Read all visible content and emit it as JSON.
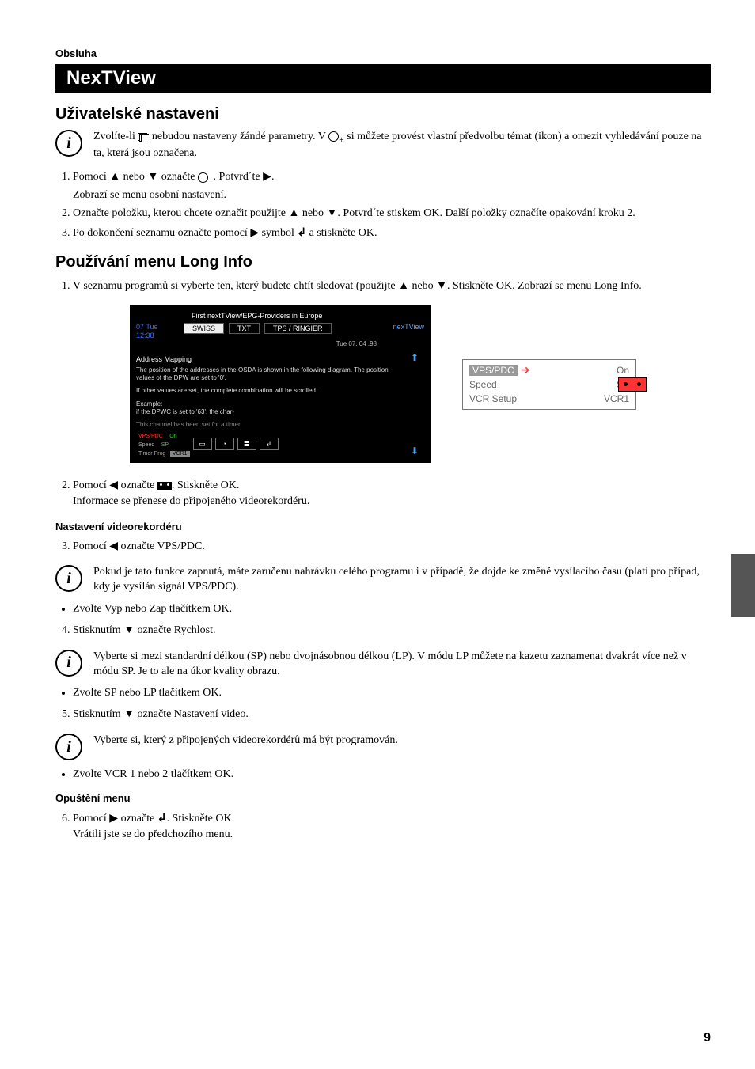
{
  "top_category": "Obsluha",
  "title_bar": "NexTView",
  "section1": {
    "heading": "Uživatelské nastaveni",
    "info": "Zvolíte-li ▤ nebudou nastaveny žándé parametry. V ☺⁺ si můžete provést vlastní předvolbu témat (ikon) a omezit vyhledávání pouze na ta, která jsou označena.",
    "steps": [
      "Pomocí ▲ nebo ▼ označte ☺⁺. Potvrd´te ▶.\nZobrazí se menu osobní nastavení.",
      "Označte položku, kterou chcete označit použijte ▲ nebo ▼. Potvrd´te stiskem OK. Další položky označíte opakování kroku 2.",
      "Po dokončení seznamu označte pomocí ▶ symbol ↲ a stiskněte OK."
    ]
  },
  "section2": {
    "heading": "Používání menu Long Info",
    "step1": "V seznamu programů si vyberte ten, který budete chtít sledovat (použijte ▲ nebo ▼. Stiskněte OK. Zobrazí se menu Long Info."
  },
  "epg": {
    "title": "First nextTView/EPG-Providers in Europe",
    "date": "07 Tue",
    "time": "12:38",
    "tabs": [
      "SWISS",
      "TXT",
      "TPS / RINGIER"
    ],
    "subdate": "Tue 07. 04 .98",
    "brand": "nexTView",
    "heading": "Address Mapping",
    "body1": "The position of the addresses in the OSDA is shown in the following diagram. The position values of the DPW are set to '0'.",
    "body2": "If other values are set, the complete combination will be scrolled.",
    "body3": "Example:\nif the DPWC is set to '63', the char-",
    "footer_note": "This channel has been set for a timer",
    "chips": {
      "vps": "VPS/PDC",
      "on": "On",
      "speed": "Speed",
      "sp": "SP",
      "timer": "Timer Prog",
      "vcr": "VCR1"
    }
  },
  "vcr_panel": {
    "rows": [
      {
        "label": "VPS/PDC",
        "value": "On",
        "highlight": true
      },
      {
        "label": "Speed",
        "value": "SP"
      },
      {
        "label": "VCR Setup",
        "value": "VCR1"
      }
    ]
  },
  "after_figure": {
    "step2": "Pomocí ◀ označte ▭. Stiskněte OK.\nInformace se přenese do připojeného videorekordéru.",
    "sub_heading": "Nastavení videorekordéru",
    "step3": "Pomocí ◀ označte VPS/PDC.",
    "info3": "Pokud je tato funkce zapnutá, máte zaručenu nahrávku celého programu i v případě, že dojde ke změně vysílacího času (platí pro případ, kdy je vysílán signál VPS/PDC).",
    "bullet3": "Zvolte Vyp nebo Zap tlačítkem OK.",
    "step4": "Stisknutím ▼ označte Rychlost.",
    "info4": "Vyberte si mezi standardní délkou (SP) nebo dvojnásobnou délkou (LP). V módu LP můžete na kazetu zaznamenat dvakrát více než v módu SP. Je to ale na úkor kvality obrazu.",
    "bullet4": "Zvolte SP nebo LP tlačítkem OK.",
    "step5": "Stisknutím ▼ označte Nastavení video.",
    "info5": "Vyberte si, který z připojených videorekordérů má být programován.",
    "bullet5": "Zvolte VCR 1 nebo 2 tlačítkem OK.",
    "leave_heading": "Opuštění menu",
    "step6": "Pomocí ▶ označte ↲. Stiskněte OK.\nVrátili jste se do předchozího menu."
  },
  "page_number": "9"
}
